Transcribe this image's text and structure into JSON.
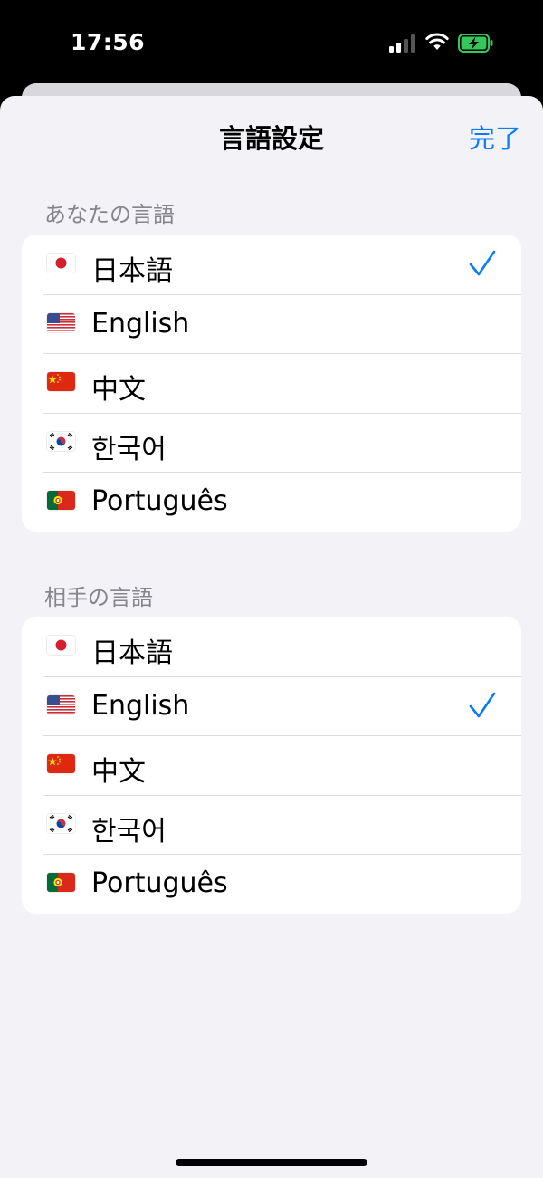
{
  "status_bar": {
    "time": "17:56"
  },
  "nav": {
    "title": "言語設定",
    "done_label": "完了"
  },
  "sections": [
    {
      "header": "あなたの言語",
      "items": [
        {
          "flag": "japan-flag-icon",
          "label": "日本語",
          "selected": true
        },
        {
          "flag": "usa-flag-icon",
          "label": "English",
          "selected": false
        },
        {
          "flag": "china-flag-icon",
          "label": "中文",
          "selected": false
        },
        {
          "flag": "korea-flag-icon",
          "label": "한국어",
          "selected": false
        },
        {
          "flag": "portugal-flag-icon",
          "label": "Português",
          "selected": false
        }
      ]
    },
    {
      "header": "相手の言語",
      "items": [
        {
          "flag": "japan-flag-icon",
          "label": "日本語",
          "selected": false
        },
        {
          "flag": "usa-flag-icon",
          "label": "English",
          "selected": true
        },
        {
          "flag": "china-flag-icon",
          "label": "中文",
          "selected": false
        },
        {
          "flag": "korea-flag-icon",
          "label": "한국어",
          "selected": false
        },
        {
          "flag": "portugal-flag-icon",
          "label": "Português",
          "selected": false
        }
      ]
    }
  ],
  "colors": {
    "accent": "#0a7aff",
    "background": "#f2f2f7",
    "battery": "#34c759"
  }
}
